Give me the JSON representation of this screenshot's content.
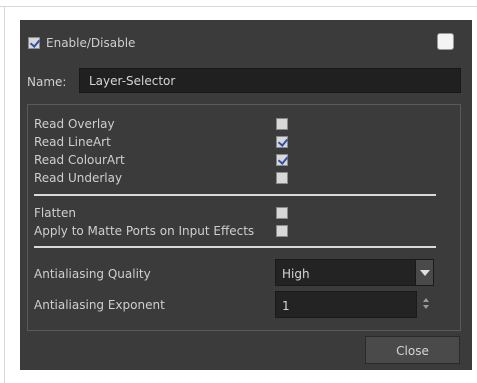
{
  "dialog": {
    "enable_label": "Enable/Disable",
    "enable_checked": true,
    "swatch_color": "#f4f4f4",
    "name_label": "Name:",
    "name_value": "Layer-Selector",
    "options": [
      {
        "label": "Read Overlay",
        "checked": false
      },
      {
        "label": "Read LineArt",
        "checked": true
      },
      {
        "label": "Read ColourArt",
        "checked": true
      },
      {
        "label": "Read Underlay",
        "checked": false
      }
    ],
    "options2": [
      {
        "label": "Flatten",
        "checked": false
      },
      {
        "label": "Apply to Matte Ports on Input Effects",
        "checked": false
      }
    ],
    "antialiasing_quality_label": "Antialiasing Quality",
    "antialiasing_quality_value": "High",
    "antialiasing_exponent_label": "Antialiasing Exponent",
    "antialiasing_exponent_value": "1",
    "close_label": "Close"
  },
  "colors": {
    "panel_bg": "#3b3b3b",
    "field_bg": "#202020",
    "check_mark": "#2c4fa8"
  }
}
